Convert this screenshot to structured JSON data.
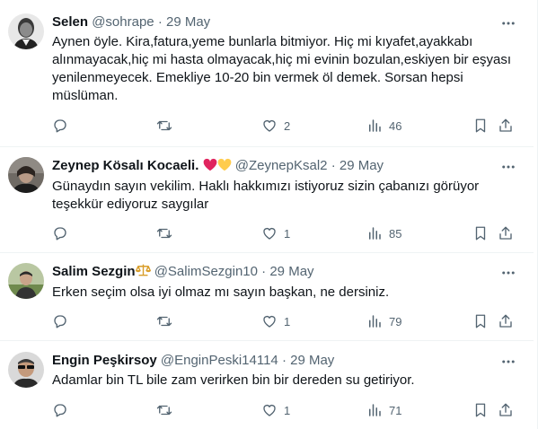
{
  "tweets": [
    {
      "name": "Selen",
      "handle": "@sohrape",
      "sep": "·",
      "date": "29 May",
      "text": "Aynen öyle. Kira,fatura,yeme bunlarla bitmiyor. Hiç mi kıyafet,ayakkabı alınmayacak,hiç mi hasta olmayacak,hiç mi evinin bozulan,eskiyen bir eşyası yenilenmeyecek. Emekliye 10-20 bin vermek öl demek. Sorsan hepsi müslüman.",
      "likes": "2",
      "views": "46"
    },
    {
      "name": "Zeynep Kösalı Kocaeli.",
      "handle": "@ZeynepKsal2",
      "sep": "·",
      "date": "29 May",
      "text": "Günaydın sayın vekilim. Haklı hakkımızı istiyoruz sizin çabanızı görüyor teşekkür ediyoruz saygılar",
      "likes": "1",
      "views": "85"
    },
    {
      "name": "Salim Sezgin",
      "handle": "@SalimSezgin10",
      "sep": "·",
      "date": "29 May",
      "text": "Erken seçim olsa iyi olmaz mı sayın başkan, ne dersiniz.",
      "likes": "1",
      "views": "79"
    },
    {
      "name": "Engin Peşkirsoy",
      "handle": "@EnginPeski14114",
      "sep": "·",
      "date": "29 May",
      "text": "Adamlar bin TL bile zam verirken bin bir dereden su getiriyor.",
      "likes": "1",
      "views": "71"
    }
  ],
  "colors": {
    "text": "#0f1419",
    "secondary": "#536471",
    "divider": "#eff3f4",
    "heart_red": "#e0245e",
    "heart_yellow": "#ffcc4d",
    "scales_gold": "#d99e2b"
  },
  "icons": [
    "more-icon",
    "reply-icon",
    "retweet-icon",
    "like-icon",
    "views-icon",
    "bookmark-icon",
    "share-icon",
    "red-heart-emoji",
    "yellow-heart-emoji",
    "scales-emoji"
  ]
}
